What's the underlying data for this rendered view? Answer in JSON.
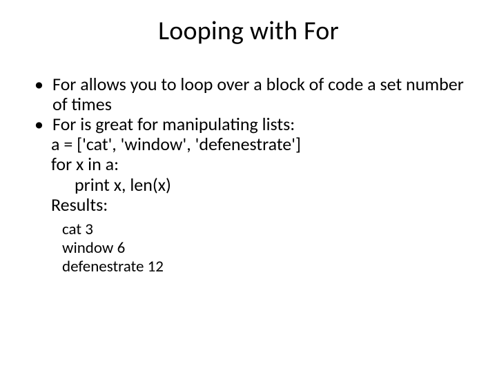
{
  "title": "Looping with For",
  "bullets": {
    "b1": "For allows you to loop over a block of code a set number of times",
    "b2": "For is great for manipulating lists:"
  },
  "code": {
    "l1": "a = ['cat', 'window', 'defenestrate']",
    "l2": "for x in a:",
    "l3": "print x, len(x)",
    "l4": "Results:"
  },
  "output": {
    "o1": "cat 3",
    "o2": "window 6",
    "o3": "defenestrate 12"
  }
}
